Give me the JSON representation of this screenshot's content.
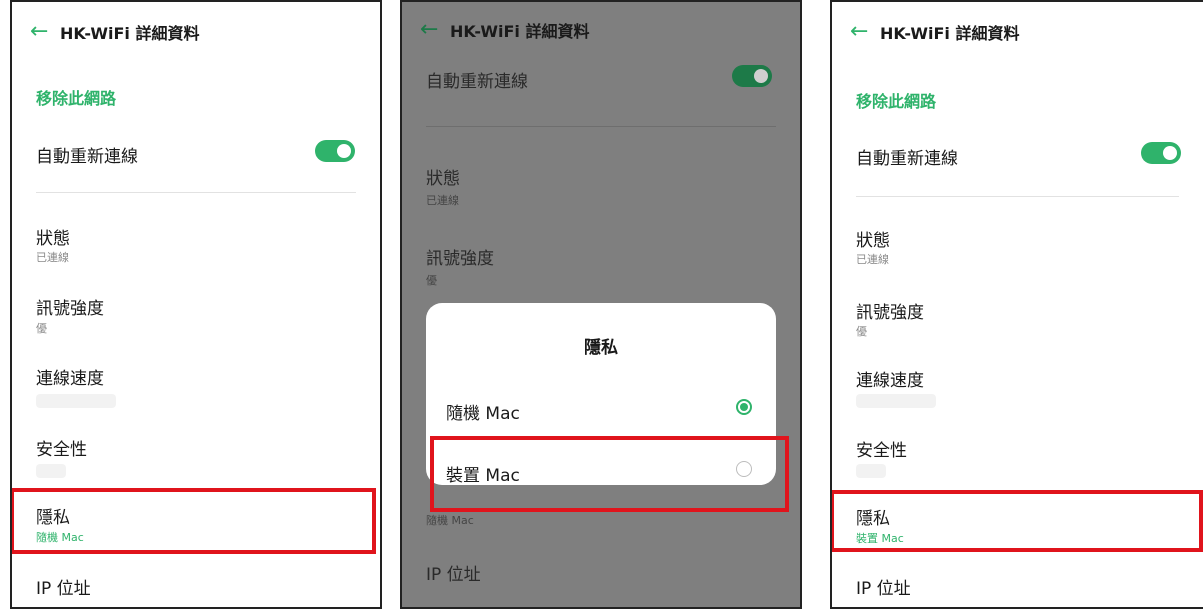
{
  "screen_title": "HK-WiFi 詳細資料",
  "remove_network": "移除此網路",
  "auto_reconnect": "自動重新連線",
  "status": {
    "label": "狀態",
    "value": "已連線"
  },
  "signal": {
    "label": "訊號強度",
    "value": "優"
  },
  "speed": {
    "label": "連線速度"
  },
  "security": {
    "label": "安全性"
  },
  "privacy": {
    "label": "隱私",
    "value_before": "隨機 Mac",
    "value_after": "裝置 Mac"
  },
  "ip": {
    "label": "IP 位址"
  },
  "dialog": {
    "title": "隱私",
    "options": [
      "隨機 Mac",
      "裝置 Mac"
    ],
    "selected_index": 0
  },
  "colors": {
    "accent": "#2fb36b",
    "highlight": "#e0141c"
  },
  "icons": {
    "back": "arrow-left-icon"
  }
}
